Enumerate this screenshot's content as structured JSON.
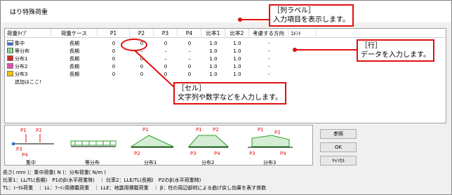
{
  "window": {
    "title": "はり特殊荷重"
  },
  "grid": {
    "headers": [
      "荷重ﾀｲﾌﾟ",
      "荷重ケース",
      "P1",
      "P2",
      "P3",
      "P4",
      "比率1",
      "比率2",
      "考慮する方向",
      "ｺﾒﾝﾄ"
    ],
    "rows": [
      {
        "type": "集中",
        "case": "長期",
        "p1": "0",
        "p2": "0",
        "p3": "0",
        "p4": "0",
        "r1": "1.0",
        "r2": "1.0",
        "dir": "-",
        "comment": ""
      },
      {
        "type": "等分布",
        "case": "長期",
        "p1": "0",
        "p2": "–",
        "p3": "–",
        "p4": "–",
        "r1": "1.0",
        "r2": "1.0",
        "dir": "-",
        "comment": ""
      },
      {
        "type": "分布1",
        "case": "長期",
        "p1": "0",
        "p2": "0",
        "p3": "–",
        "p4": "–",
        "r1": "1.0",
        "r2": "1.0",
        "dir": "-",
        "comment": ""
      },
      {
        "type": "分布2",
        "case": "長期",
        "p1": "0",
        "p2": "0",
        "p3": "0",
        "p4": "0",
        "r1": "1.0",
        "r2": "1.0",
        "dir": "-",
        "comment": ""
      },
      {
        "type": "分布3",
        "case": "長期",
        "p1": "0",
        "p2": "0",
        "p3": "0",
        "p4": "0",
        "r1": "1.0",
        "r2": "1.0",
        "dir": "-",
        "comment": ""
      }
    ],
    "add_row_label": "追加はここ!",
    "row_icons": [
      "concentrated-load-icon",
      "uniform-load-icon",
      "distribution1-icon",
      "distribution2-icon",
      "distribution3-icon"
    ]
  },
  "diagrams": {
    "labels": [
      "集中",
      "等分布",
      "分布1",
      "分布2",
      "分布3"
    ],
    "p_labels": [
      "P1",
      "P2",
      "P3",
      "P4"
    ],
    "accent_color": "#e01010",
    "load_color": "#2ca02c"
  },
  "buttons": {
    "reference": "参照",
    "ok": "OK",
    "cancel": "ｷｬﾝｾﾙ"
  },
  "footer": {
    "line1": "長さ( mm )：集中荷重( N )：分布荷重( N/m )",
    "line2": "比率1：LL/TL(長期)　P1のβ(水平荷重時)　｜ 比率2：LLE/TL(長期)　P2のβ(水平荷重時)",
    "line3": "TL：ﾄｰﾀﾙ荷重　｜ LL：ﾗｰﾒﾝ用積載荷重　｜ LLE：地震用積載荷重　｜ β：柱の周辺部材による曲げ戻し効果を表す係数"
  },
  "callouts": {
    "column": {
      "line1": "［列ラベル］",
      "line2": "入力項目を表示します。"
    },
    "row": {
      "line1": "［行］",
      "line2": "データを入力します。"
    },
    "cell": {
      "line1": "［セル］",
      "line2": "文字列や数字などを入力します。"
    }
  }
}
